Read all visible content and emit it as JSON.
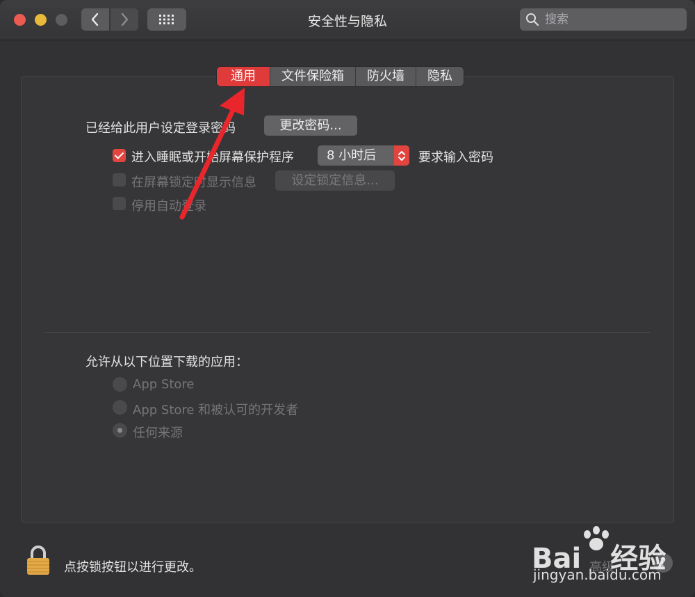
{
  "window": {
    "title": "安全性与隐私"
  },
  "search": {
    "placeholder": "搜索"
  },
  "tabs": [
    {
      "label": "通用",
      "active": true
    },
    {
      "label": "文件保险箱",
      "active": false
    },
    {
      "label": "防火墙",
      "active": false
    },
    {
      "label": "隐私",
      "active": false
    }
  ],
  "general": {
    "password_label": "已经给此用户设定登录密码",
    "change_password_button": "更改密码...",
    "sleep_checkbox_label": "进入睡眠或开始屏幕保护程序",
    "sleep_delay_value": "8 小时后",
    "require_password_label": "要求输入密码",
    "lock_message_label": "在屏幕锁定时显示信息",
    "lock_message_button": "设定锁定信息...",
    "disable_autologin_label": "停用自动登录"
  },
  "downloads": {
    "heading": "允许从以下位置下载的应用：",
    "options": [
      {
        "label": "App Store",
        "selected": false
      },
      {
        "label": "App Store 和被认可的开发者",
        "selected": false
      },
      {
        "label": "任何来源",
        "selected": true
      }
    ]
  },
  "footer": {
    "lock_message": "点按锁按钮以进行更改。",
    "advanced_label": "高级",
    "help_label": "?"
  },
  "watermark": {
    "brand": "Bai",
    "brand2": "经验",
    "url": "jingyan.baidu.com"
  },
  "colors": {
    "accent": "#e2453f",
    "annotation_arrow": "#e8262b"
  }
}
